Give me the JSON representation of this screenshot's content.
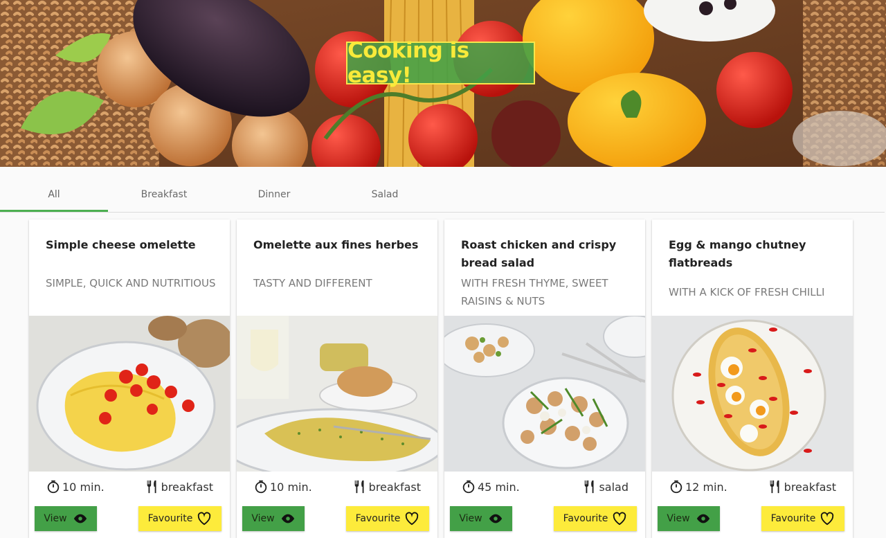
{
  "hero": {
    "title": "Cooking is easy!"
  },
  "tabs": [
    {
      "label": "All",
      "active": true
    },
    {
      "label": "Breakfast",
      "active": false
    },
    {
      "label": "Dinner",
      "active": false
    },
    {
      "label": "Salad",
      "active": false
    }
  ],
  "cards": [
    {
      "title": "Simple cheese omelette",
      "subtitle": "Simple, quick and nutritious",
      "time": "10 min.",
      "category": "breakfast",
      "view_label": "View",
      "fav_label": "Favourite"
    },
    {
      "title": "Omelette aux fines herbes",
      "subtitle": "Tasty and different",
      "time": "10 min.",
      "category": "breakfast",
      "view_label": "View",
      "fav_label": "Favourite"
    },
    {
      "title": "Roast chicken and crispy bread salad",
      "subtitle": "With fresh thyme, sweet raisins & nuts",
      "time": "45 min.",
      "category": "salad",
      "view_label": "View",
      "fav_label": "Favourite"
    },
    {
      "title": "Egg & mango chutney flatbreads",
      "subtitle": "With a kick of fresh chilli",
      "time": "12 min.",
      "category": "breakfast",
      "view_label": "View",
      "fav_label": "Favourite"
    }
  ],
  "icons": {
    "time": "timer-icon",
    "category": "cutlery-icon",
    "view": "eye-icon",
    "favourite": "heart-outline-icon"
  },
  "colors": {
    "primary": "#43a047",
    "accent": "#fdeb3b",
    "tab_indicator": "#4caf50"
  }
}
